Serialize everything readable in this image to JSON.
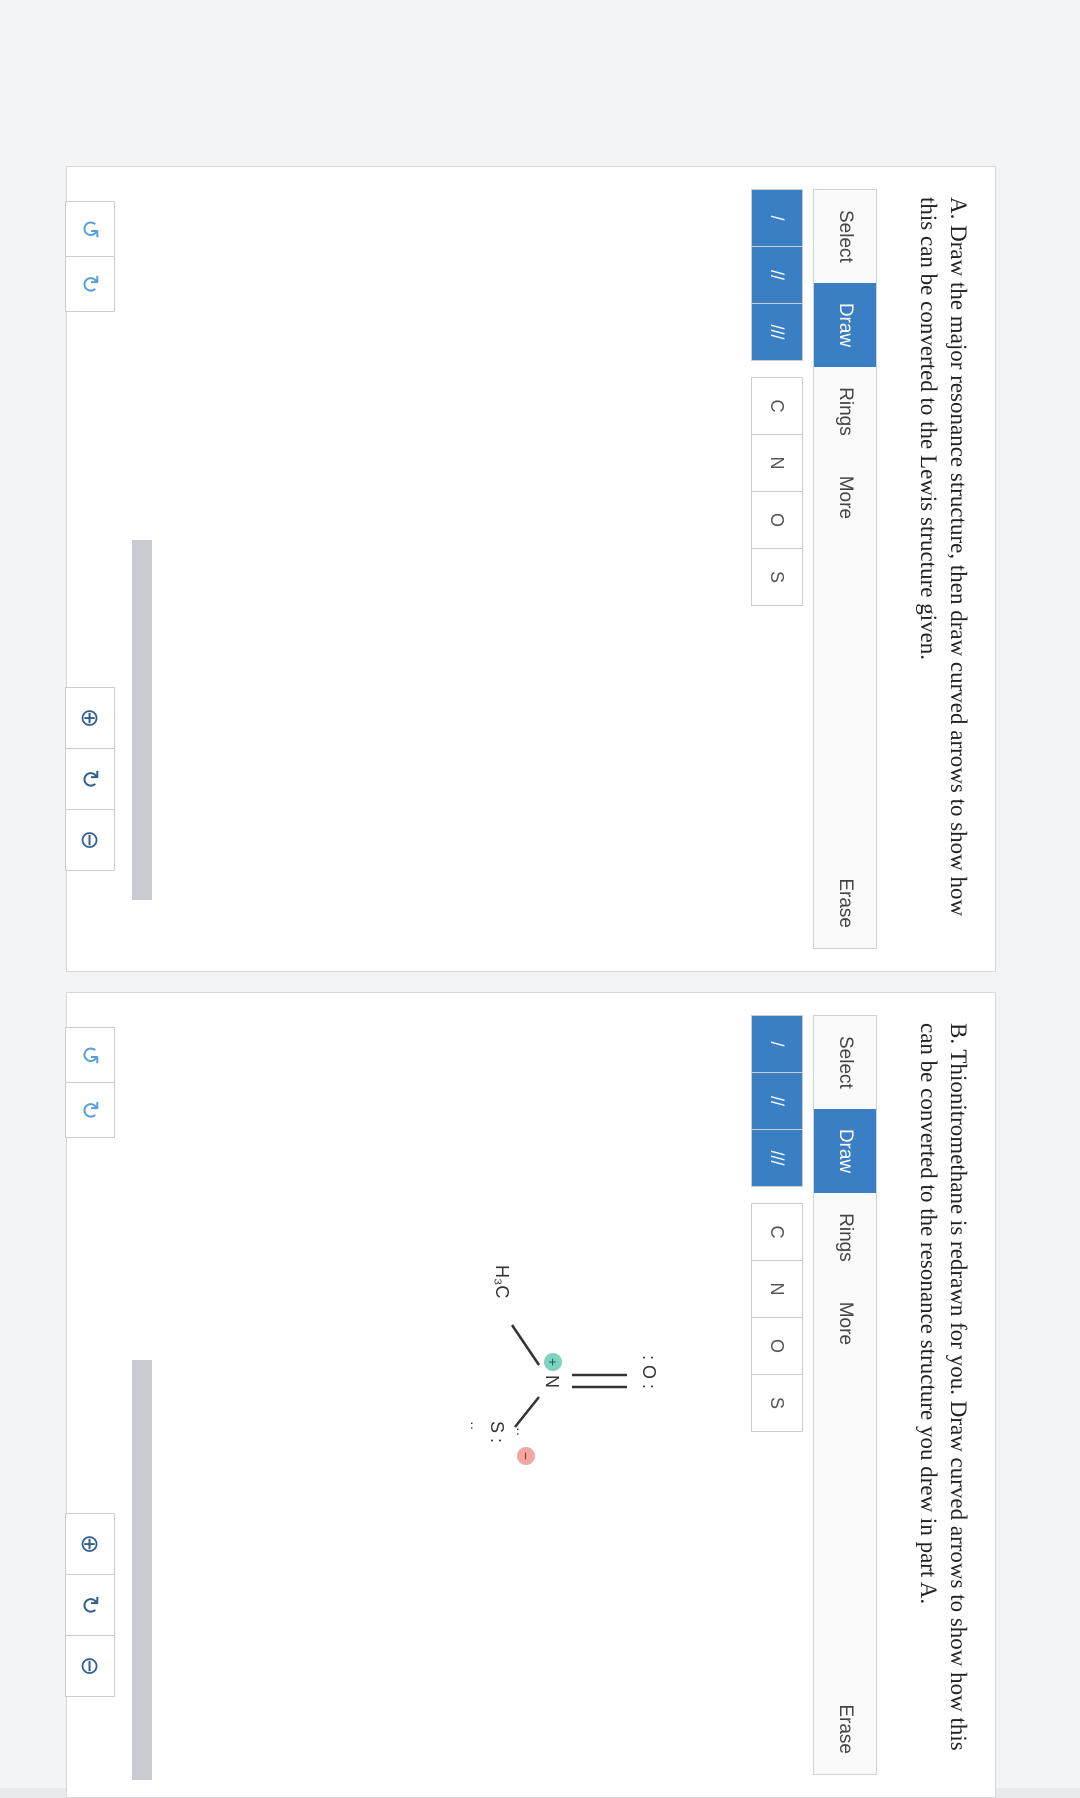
{
  "panel_a": {
    "question": "A. Draw the major resonance structure, then draw curved arrows to show how this can be converted to the Lewis structure given.",
    "tabs": [
      "Select",
      "Draw",
      "Rings",
      "More"
    ],
    "active_tab": "Draw",
    "erase_label": "Erase",
    "bond_buttons": [
      "/",
      "//",
      "///"
    ],
    "atom_buttons": [
      "C",
      "N",
      "O",
      "S"
    ]
  },
  "panel_b": {
    "question": "B. Thionitromethane is redrawn for you. Draw curved arrows to show how this can be converted to the resonance structure you drew in part A.",
    "tabs": [
      "Select",
      "Draw",
      "Rings",
      "More"
    ],
    "active_tab": "Draw",
    "erase_label": "Erase",
    "bond_buttons": [
      "/",
      "//",
      "///"
    ],
    "atom_buttons": [
      "C",
      "N",
      "O",
      "S"
    ],
    "molecule": {
      "o_label": ": O :",
      "n_label": "N",
      "n_charge": "+",
      "s_label": "S :",
      "s_charge": "−",
      "s_lone_top": "··",
      "s_lone_bottom": "··",
      "ch3_label": "H₃C"
    }
  },
  "icons": {
    "undo": "↺",
    "redo": "↻",
    "zoom_in": "⊕",
    "zoom_reset": "↻",
    "zoom_out": "⊖"
  },
  "colors": {
    "accent": "#3a7fc4",
    "positive_charge": "#7dd3c0",
    "negative_charge": "#f3a6a6"
  }
}
